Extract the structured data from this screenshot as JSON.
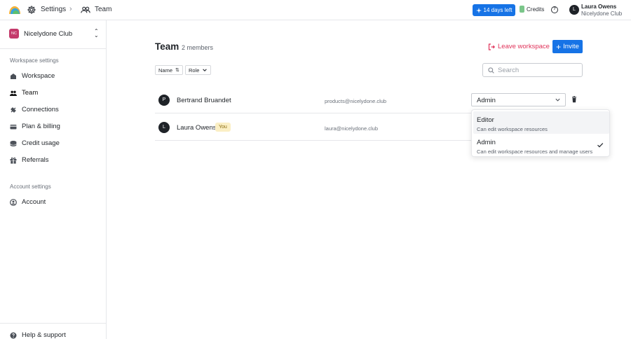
{
  "topbar": {
    "breadcrumb_settings": "Settings",
    "breadcrumb_team": "Team",
    "trial_label": "14 days left",
    "credits_label": "Credits",
    "user_initial": "L",
    "user_name": "Laura Owens",
    "user_workspace": "Nicelydone Club",
    "accent_color": "#1673e6"
  },
  "sidebar": {
    "workspace_badge": "NC",
    "workspace_name": "Nicelydone Club",
    "workspace_section_label": "Workspace settings",
    "items": [
      {
        "label": "Workspace",
        "icon": "building-icon"
      },
      {
        "label": "Team",
        "icon": "users-icon",
        "active": true
      },
      {
        "label": "Connections",
        "icon": "plug-icon"
      },
      {
        "label": "Plan & billing",
        "icon": "card-icon"
      },
      {
        "label": "Credit usage",
        "icon": "coins-icon"
      },
      {
        "label": "Referrals",
        "icon": "gift-icon"
      }
    ],
    "account_section_label": "Account settings",
    "account_item": {
      "label": "Account",
      "icon": "user-circle-icon"
    },
    "help_label": "Help & support"
  },
  "main": {
    "title": "Team",
    "member_count": "2 members",
    "leave_label": "Leave workspace",
    "invite_label": "Invite",
    "sort_name_label": "Name",
    "sort_role_label": "Role",
    "search_placeholder": "Search",
    "members": [
      {
        "initial": "P",
        "name": "Bertrand Bruandet",
        "email": "products@nicelydone.club",
        "role": "Admin"
      },
      {
        "initial": "L",
        "name": "Laura Owens",
        "badge": "You",
        "email": "laura@nicelydone.club"
      }
    ]
  },
  "role_dropdown": {
    "options": [
      {
        "title": "Editor",
        "description": "Can edit workspace resources"
      },
      {
        "title": "Admin",
        "description": "Can edit workspace resources and manage users",
        "selected": true
      }
    ]
  }
}
